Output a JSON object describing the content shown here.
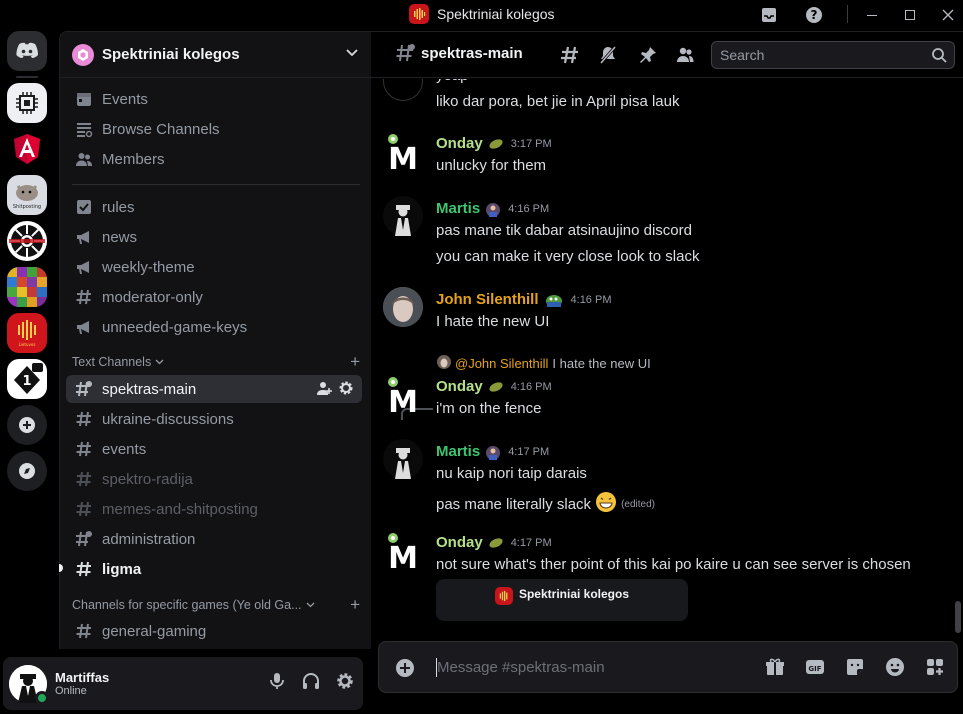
{
  "window": {
    "title": "Spektriniai kolegos"
  },
  "guild": {
    "name": "Spektriniai kolegos"
  },
  "sidebar": {
    "top_items": [
      {
        "label": "Events",
        "icon": "calendar-icon"
      },
      {
        "label": "Browse Channels",
        "icon": "browse-icon"
      },
      {
        "label": "Members",
        "icon": "members-icon"
      }
    ],
    "channels_top": [
      {
        "label": "rules",
        "icon": "rules-icon"
      },
      {
        "label": "news",
        "icon": "megaphone-icon"
      },
      {
        "label": "weekly-theme",
        "icon": "megaphone-icon"
      },
      {
        "label": "moderator-only",
        "icon": "hash-icon"
      },
      {
        "label": "unneeded-game-keys",
        "icon": "megaphone-icon"
      }
    ],
    "category_text": "Text Channels",
    "text_channels": [
      {
        "label": "spektras-main",
        "state": "active"
      },
      {
        "label": "ukraine-discussions",
        "state": "normal"
      },
      {
        "label": "events",
        "state": "normal"
      },
      {
        "label": "spektro-radija",
        "state": "muted"
      },
      {
        "label": "memes-and-shitposting",
        "state": "muted"
      },
      {
        "label": "administration",
        "state": "normal"
      },
      {
        "label": "ligma",
        "state": "unread"
      }
    ],
    "category_games": "Channels for specific games (Ye old Ga...",
    "game_channels": [
      {
        "label": "general-gaming"
      }
    ]
  },
  "user": {
    "name": "Martiffas",
    "status": "Online"
  },
  "chat": {
    "channel_name": "spektras-main",
    "search_placeholder": "Search",
    "composer_placeholder": "Message #spektras-main",
    "messages": [
      {
        "lines": [
          "yeap",
          "liko dar pora, bet jie in April pisa lauk"
        ]
      },
      {
        "author": "Onday",
        "color": "#b5e08a",
        "time": "3:17 PM",
        "lines": [
          "unlucky for them"
        ]
      },
      {
        "author": "Martis",
        "color": "#3ec56f",
        "time": "4:16 PM",
        "lines": [
          "pas mane tik dabar atsinaujino discord",
          "you can make it very close look to slack"
        ]
      },
      {
        "author": "John Silenthill",
        "color": "#e4a21a",
        "time": "4:16 PM",
        "lines": [
          "I hate the new UI"
        ]
      },
      {
        "reply_to": "@John Silenthill",
        "reply_text": "I hate the new UI",
        "author": "Onday",
        "color": "#b5e08a",
        "time": "4:16 PM",
        "lines": [
          "i'm on the fence"
        ]
      },
      {
        "author": "Martis",
        "color": "#3ec56f",
        "time": "4:17 PM",
        "lines": [
          "nu kaip nori taip darais",
          "pas mane literally slack"
        ],
        "edited": "(edited)"
      },
      {
        "author": "Onday",
        "color": "#b5e08a",
        "time": "4:17 PM",
        "lines": [
          "not sure what's ther point of this kai po kaire u can see server is chosen"
        ],
        "embed": "Spektriniai kolegos"
      }
    ]
  }
}
